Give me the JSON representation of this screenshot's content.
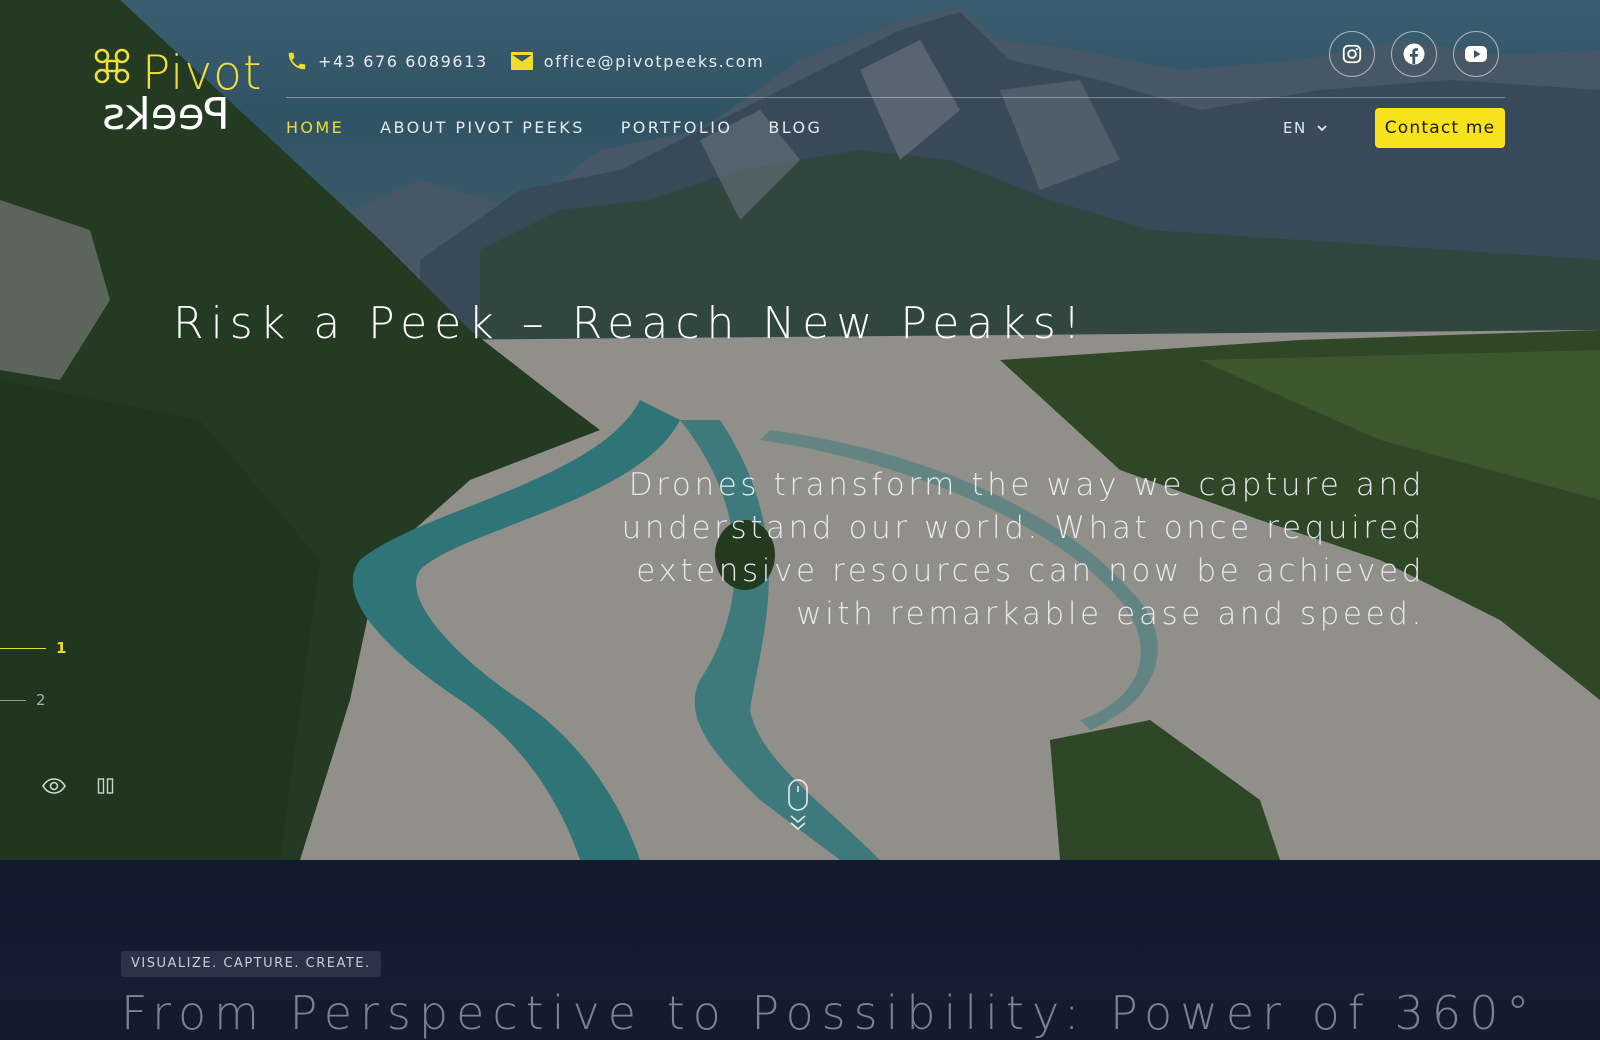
{
  "brand": {
    "logo_word_top": "Pivot",
    "logo_word_bottom": "Peeks",
    "accent_color": "#f2dc2a"
  },
  "contact": {
    "phone": "+43 676 6089613",
    "email": "office@pivotpeeks.com",
    "phone_icon": "phone-icon",
    "email_icon": "mail-icon"
  },
  "social": [
    {
      "name": "instagram-icon"
    },
    {
      "name": "facebook-icon"
    },
    {
      "name": "youtube-icon"
    }
  ],
  "nav": {
    "items": [
      {
        "label": "HOME",
        "active": true
      },
      {
        "label": "ABOUT PIVOT PEEKS",
        "active": false
      },
      {
        "label": "PORTFOLIO",
        "active": false
      },
      {
        "label": "BLOG",
        "active": false
      }
    ],
    "language": "EN",
    "cta_label": "Contact me",
    "cta_color": "#f7e21b"
  },
  "hero": {
    "headline": "Risk a Peek – Reach New Peaks!",
    "subtext_lines": [
      "Drones transform the way we capture and",
      "understand our world. What once required",
      "extensive resources can now be achieved",
      "with remarkable ease and speed."
    ],
    "slides": [
      "1",
      "2"
    ],
    "active_slide": "1"
  },
  "section": {
    "tag": "VISUALIZE. CAPTURE. CREATE.",
    "heading": "From Perspective to Possibility: Power of 360°"
  }
}
